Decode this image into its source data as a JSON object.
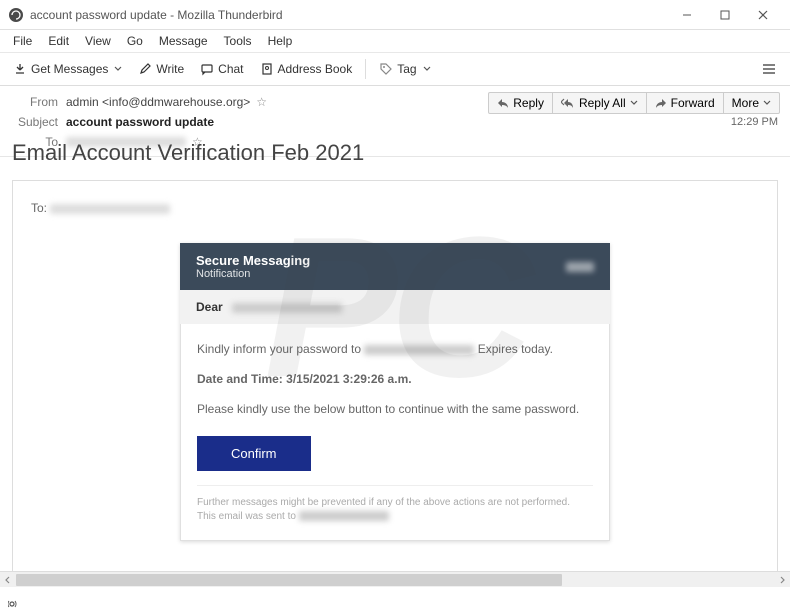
{
  "window": {
    "title": "account password update - Mozilla Thunderbird"
  },
  "menu": {
    "file": "File",
    "edit": "Edit",
    "view": "View",
    "go": "Go",
    "message": "Message",
    "tools": "Tools",
    "help": "Help"
  },
  "toolbar": {
    "get_messages": "Get Messages",
    "write": "Write",
    "chat": "Chat",
    "address_book": "Address Book",
    "tag": "Tag"
  },
  "header": {
    "from_label": "From",
    "from_value": "admin <info@ddmwarehouse.org>",
    "subject_label": "Subject",
    "subject_value": "account password update",
    "to_label": "To",
    "time": "12:29 PM"
  },
  "actions": {
    "reply": "Reply",
    "reply_all": "Reply All",
    "forward": "Forward",
    "more": "More"
  },
  "email": {
    "title": "Email Account Verification Feb 2021",
    "to_label": "To:",
    "secure_h1": "Secure Messaging",
    "secure_h2": "Notification",
    "dear": "Dear",
    "line1a": "Kindly inform your password to ",
    "line1b": " Expires today.",
    "date_time_label": "Date and Time: ",
    "date_time_value": "3/15/2021 3:29:26 a.m.",
    "line3": "Please kindly use the below button to continue with the same password.",
    "confirm": "Confirm",
    "foot1": "Further messages might be prevented if any of the above actions are not performed.",
    "foot2": "This email was sent to "
  }
}
